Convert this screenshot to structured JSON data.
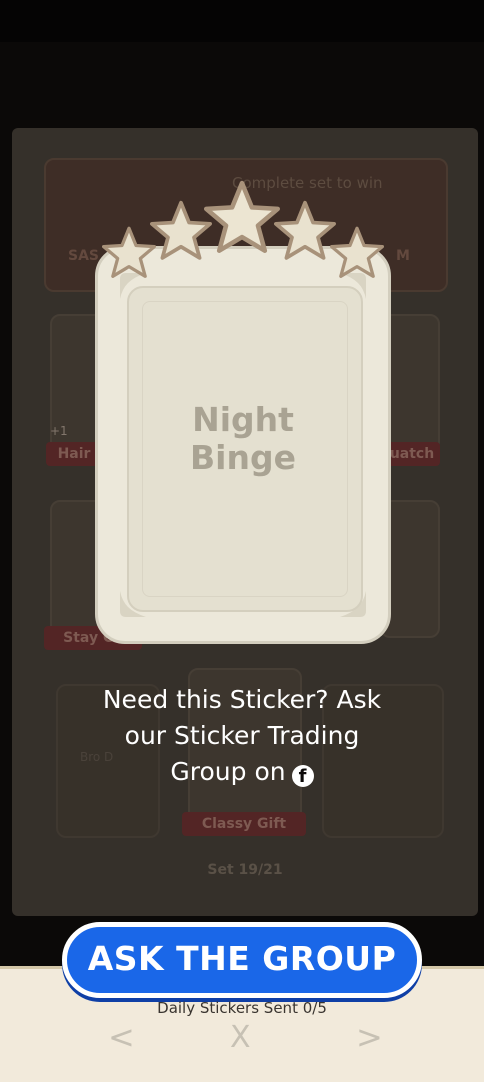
{
  "background_album": {
    "banner_text": "Complete set to win",
    "side_left": "SAS",
    "side_right": "M",
    "plus_badge": "+1",
    "labels": [
      "Hair",
      "uatch",
      "Stay Co",
      "Classy Gift"
    ],
    "faint_left": "Bro D",
    "faint_right": "...",
    "set_progress": "Set 19/21"
  },
  "sticker": {
    "name_line1": "Night",
    "name_line2": "Binge",
    "stars": 5
  },
  "prompt": {
    "line1": "Need this Sticker? Ask",
    "line2": "our Sticker Trading",
    "line3": "Group on"
  },
  "icons": {
    "facebook": "facebook-icon",
    "prev": "chevron-left-icon",
    "next": "chevron-right-icon",
    "close": "close-icon"
  },
  "actions": {
    "ask_button": "ASK THE GROUP",
    "daily_sent": "Daily Stickers Sent 0/5",
    "prev_symbol": "<",
    "next_symbol": ">",
    "close_symbol": "X"
  }
}
